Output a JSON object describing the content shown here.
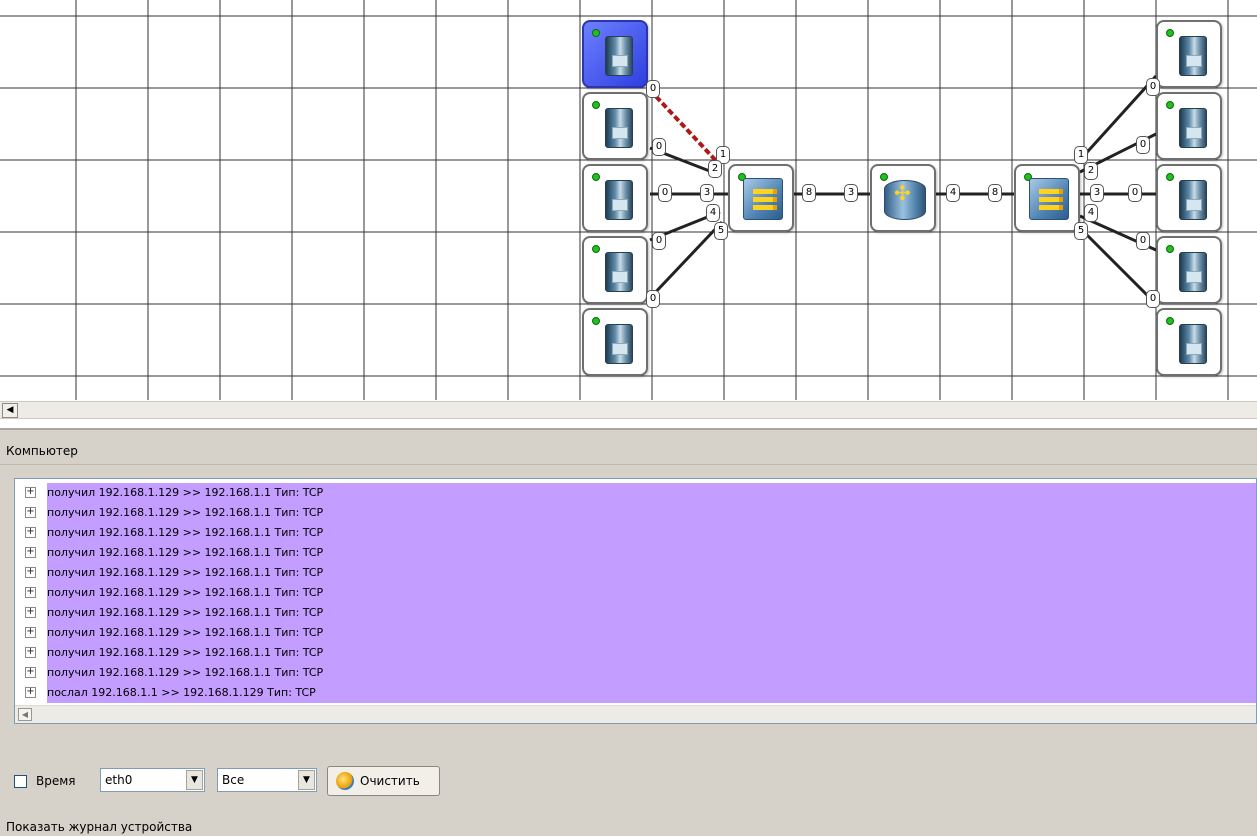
{
  "topology": {
    "ports": {
      "pc_left_1": "0",
      "pc_left_2": "0",
      "pc_left_3": "0",
      "pc_left_4": "0",
      "pc_left_5": "0",
      "sw1_a": "1",
      "sw1_b": "2",
      "sw1_c": "3",
      "sw1_d": "4",
      "sw1_e": "5",
      "sw1_r": "8",
      "rt_l": "3",
      "rt_r": "4",
      "sw2_l": "8",
      "sw2_a": "1",
      "sw2_b": "2",
      "sw2_c": "3",
      "sw2_d": "4",
      "sw2_e": "5",
      "pc_right_1": "0",
      "pc_right_2": "0",
      "pc_right_3": "0",
      "pc_right_4": "0",
      "pc_right_5": "0"
    }
  },
  "panel": {
    "title": "Компьютер"
  },
  "log": [
    "получил 192.168.1.129 >> 192.168.1.1 Тип:  TCP",
    "получил 192.168.1.129 >> 192.168.1.1 Тип:  TCP",
    "получил 192.168.1.129 >> 192.168.1.1 Тип:  TCP",
    "получил 192.168.1.129 >> 192.168.1.1 Тип:  TCP",
    "получил 192.168.1.129 >> 192.168.1.1 Тип:  TCP",
    "получил 192.168.1.129 >> 192.168.1.1 Тип:  TCP",
    "получил 192.168.1.129 >> 192.168.1.1 Тип:  TCP",
    "получил 192.168.1.129 >> 192.168.1.1 Тип:  TCP",
    "получил 192.168.1.129 >> 192.168.1.1 Тип:  TCP",
    "получил 192.168.1.129 >> 192.168.1.1 Тип:  TCP",
    "послал 192.168.1.1 >> 192.168.1.129 Тип:  TCP"
  ],
  "toolbar": {
    "time_label": "Время",
    "time_checked": false,
    "interface_value": "eth0",
    "filter_value": "Все",
    "clear_label": "Очистить"
  },
  "footer": {
    "show_log_label": "Показать журнал устройства"
  },
  "colors": {
    "log_highlight": "#c39dff",
    "selected_node": "#3a4cf0",
    "link_active": "#b01818",
    "status_led": "#20c020"
  },
  "icons": {
    "expand": "plus-box-icon",
    "scroll_left": "arrow-left-icon",
    "dropdown": "chevron-down-icon",
    "clear": "broom-icon"
  }
}
